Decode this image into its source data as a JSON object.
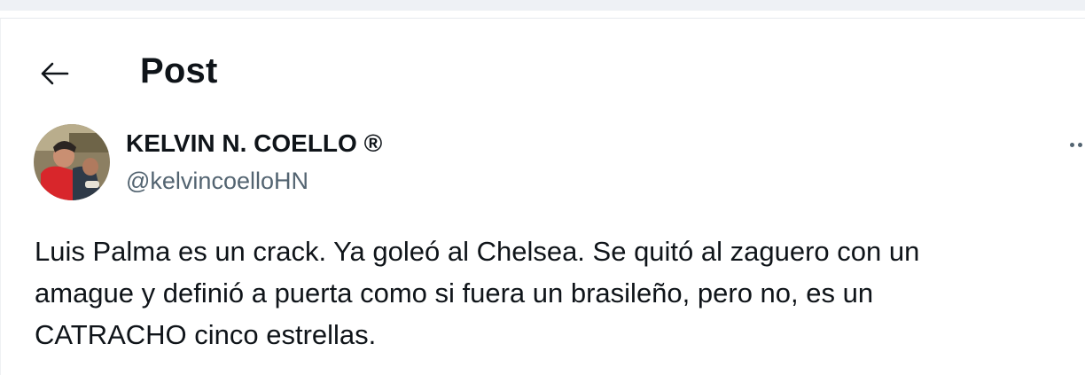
{
  "header": {
    "title": "Post",
    "back_icon": "arrow-left-icon"
  },
  "post": {
    "author": {
      "name": "KELVIN N. COELLO ®",
      "handle": "@kelvincoelloHN",
      "avatar_icon": "avatar-photo"
    },
    "more_icon": "more-horizontal-icon",
    "text": "Luis Palma es un crack. Ya goleó al Chelsea. Se quitó al zaguero con un\namague y definió a puerta como si fuera un brasileño, pero no, es un\nCATRACHO cinco estrellas."
  },
  "colors": {
    "text_primary": "#0f1419",
    "text_secondary": "#536471",
    "background": "#ffffff",
    "top_strip": "#eef1f5"
  }
}
